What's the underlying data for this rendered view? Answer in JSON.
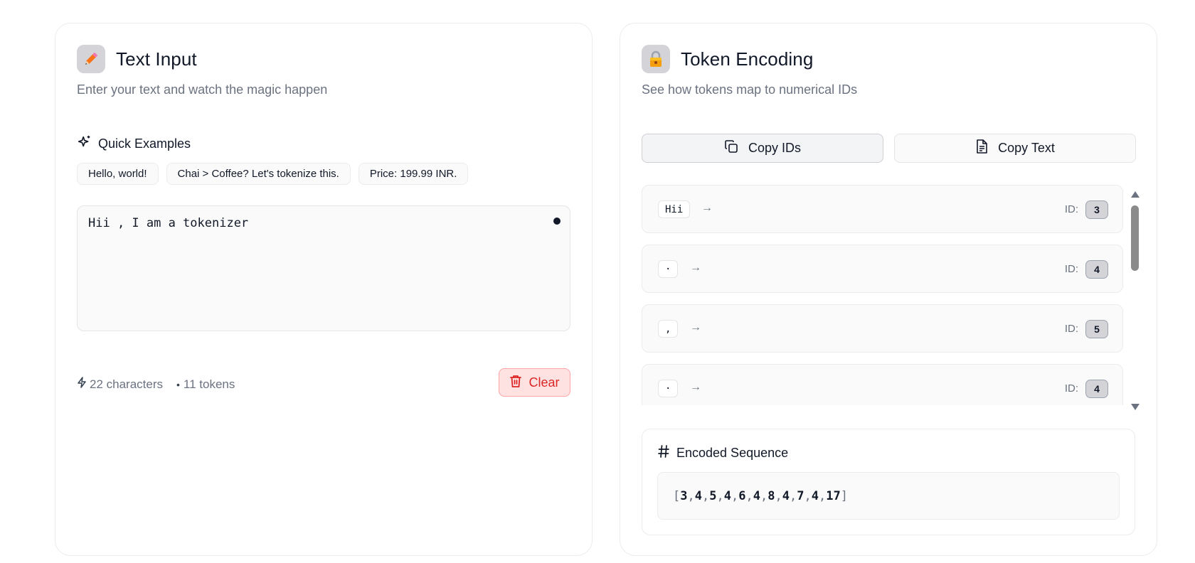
{
  "left_card": {
    "icon": "pencil-icon",
    "title": "Text Input",
    "subtitle": "Enter your text and watch the magic happen",
    "quick_examples": {
      "icon": "sparkles-icon",
      "title": "Quick Examples",
      "chips": [
        "Hello, world!",
        "Chai > Coffee? Let's tokenize this.",
        "Price: 199.99 INR."
      ]
    },
    "input": {
      "value": "Hii , I am a tokenizer"
    },
    "stats": {
      "characters": "22 characters",
      "tokens": "11 tokens",
      "separator": "•"
    },
    "clear_label": "Clear"
  },
  "right_card": {
    "icon": "lock-icon",
    "title": "Token Encoding",
    "subtitle": "See how tokens map to numerical IDs",
    "copy_ids_label": "Copy IDs",
    "copy_text_label": "Copy Text",
    "id_label": "ID:",
    "tokens": [
      {
        "token": "Hii",
        "id": "3"
      },
      {
        "token": "·",
        "id": "4"
      },
      {
        "token": ",",
        "id": "5"
      },
      {
        "token": "·",
        "id": "4"
      }
    ],
    "encoded": {
      "title": "Encoded Sequence",
      "open": "[",
      "close": "]",
      "ids": [
        "3",
        "4",
        "5",
        "4",
        "6",
        "4",
        "8",
        "4",
        "7",
        "4",
        "17"
      ]
    }
  },
  "colors": {
    "accent_red": "#dc2626",
    "text": "#111827",
    "muted": "#6b7280"
  }
}
